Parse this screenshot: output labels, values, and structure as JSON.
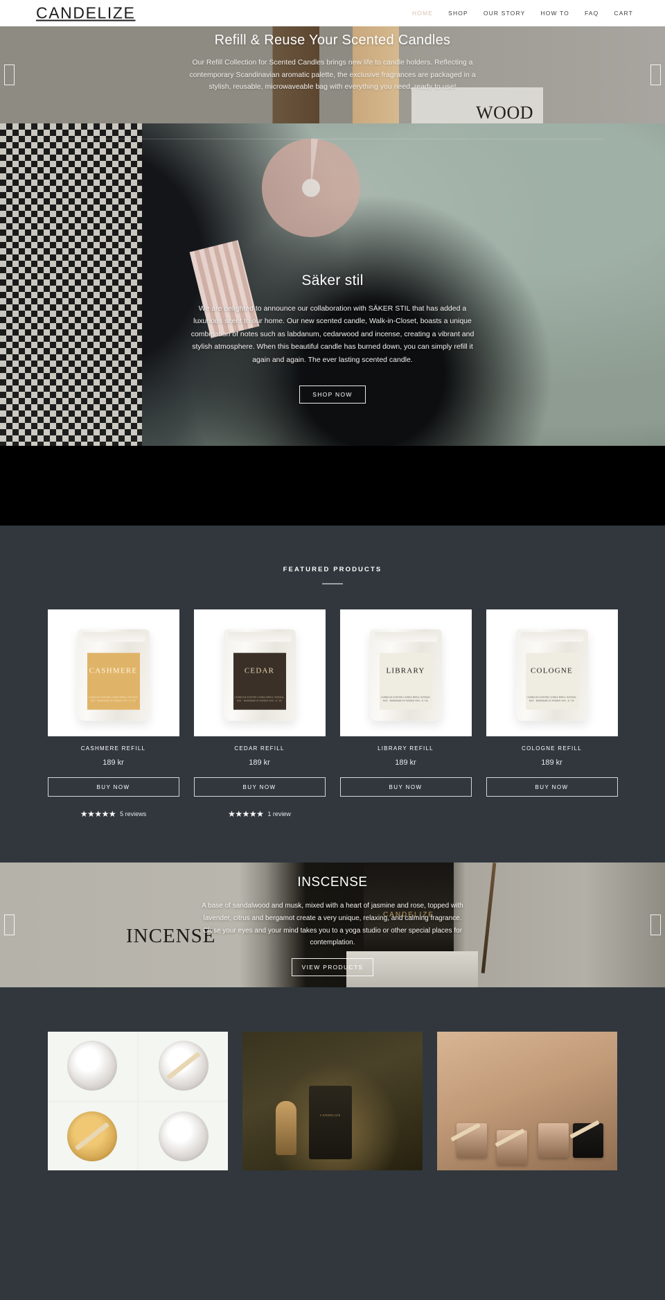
{
  "header": {
    "brand": "CANDELIZE",
    "nav": [
      {
        "label": "HOME",
        "active": true
      },
      {
        "label": "SHOP",
        "active": false
      },
      {
        "label": "OUR STORY",
        "active": false
      },
      {
        "label": "HOW TO",
        "active": false
      },
      {
        "label": "FAQ",
        "active": false
      },
      {
        "label": "CART",
        "active": false
      }
    ]
  },
  "hero_refill": {
    "title": "Refill & Reuse Your Scented Candles",
    "body": "Our Refill Collection for Scented Candles brings new life to candle holders. Reflecting a contemporary Scandinavian aromatic palette, the exclusive fragrances are packaged in a stylish, reusable, microwaveable bag with everything you need, ready to use!",
    "image_word": "WOOD",
    "prev_label": "‹",
    "next_label": "›"
  },
  "hero_saker": {
    "title": "Säker stil",
    "body": "We are delighted to announce our collaboration with SÄKER STIL that has added a luxurious scent to our home. Our new scented candle, Walk-in-Closet, boasts a unique combination of notes such as labdanum, cedarwood and incense, creating a vibrant and stylish atmosphere. When this beautiful candle has burned down, you can simply refill it again and again. The ever lasting scented candle.",
    "cta": "SHOP NOW"
  },
  "featured": {
    "title": "FEATURED PRODUCTS",
    "products": [
      {
        "label_word": "CASHMERE",
        "label_sub": "CANDELIZE\nSCENTED CANDLE REFILL\nNATURAL WAX · HANDMADE IN SWEDEN\n190G / 6.7 OZ",
        "name": "CASHMERE REFILL",
        "price": "189 kr",
        "buy_label": "BUY NOW",
        "stars": "★★★★★",
        "reviews": "5 reviews",
        "label_bg": "#e0b468",
        "label_color": "#fdf4e2"
      },
      {
        "label_word": "CEDAR",
        "label_sub": "CANDELIZE\nSCENTED CANDLE REFILL\nNATURAL WAX · HANDMADE IN SWEDEN\n190G / 6.7 OZ",
        "name": "CEDAR REFILL",
        "price": "189 kr",
        "buy_label": "BUY NOW",
        "stars": "★★★★★",
        "reviews": "1 review",
        "label_bg": "#3a3028",
        "label_color": "#e8d7ae"
      },
      {
        "label_word": "LIBRARY",
        "label_sub": "CANDELIZE\nSCENTED CANDLE REFILL\nNATURAL WAX · HANDMADE IN SWEDEN\n190G / 6.7 OZ",
        "name": "LIBRARY REFILL",
        "price": "189 kr",
        "buy_label": "BUY NOW",
        "stars": "",
        "reviews": "",
        "label_bg": "#efece2",
        "label_color": "#24221e"
      },
      {
        "label_word": "COLOGNE",
        "label_sub": "CANDELIZE\nSCENTED CANDLE REFILL\nNATURAL WAX · HANDMADE IN SWEDEN\n190G / 6.7 OZ",
        "name": "COLOGNE REFILL",
        "price": "189 kr",
        "buy_label": "BUY NOW",
        "stars": "",
        "reviews": "",
        "label_bg": "#efece2",
        "label_color": "#24221e"
      }
    ]
  },
  "incense": {
    "title": "INSCENSE",
    "body": "A base of sandalwood and musk, mixed with a heart of jasmine and rose, topped with lavender, citrus and bergamot create a very unique, relaxing, and calming fragrance. Close your eyes and your mind takes you to a yoga studio or other special places for contemplation.",
    "cta": "VIEW PRODUCTS",
    "image_word": "INCENSE",
    "jar_label": "CANDELIZE",
    "prev_label": "‹",
    "next_label": "›"
  },
  "gallery": {
    "items": [
      {
        "alt": "candle-making-steps-collage"
      },
      {
        "alt": "dark-candle-and-diffuser-photo"
      },
      {
        "alt": "candle-jars-with-wicks-photo"
      }
    ]
  },
  "colors": {
    "dark_section": "#31373d",
    "accent_nav": "#d7c3ae",
    "white": "#ffffff"
  }
}
